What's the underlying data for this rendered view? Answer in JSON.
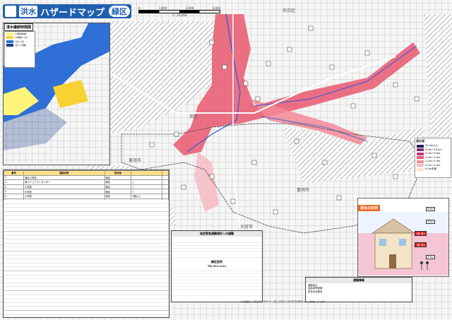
{
  "header": {
    "logo_text": "",
    "keyword": "洪水",
    "title": "ハザードマップ",
    "ward": "緑区",
    "scale_labels": [
      "0",
      "1,000",
      "2,000",
      "3,000"
    ],
    "scale_ratio": "1 : 20,000"
  },
  "map": {
    "place_labels": [
      {
        "text": "天白区",
        "name": "label-tempaku"
      },
      {
        "text": "南区",
        "name": "label-minami"
      },
      {
        "text": "豊明市",
        "name": "label-toyoake"
      },
      {
        "text": "大府市",
        "name": "label-obu"
      },
      {
        "text": "東海市",
        "name": "label-tokai"
      }
    ],
    "colors": {
      "flood_deep": "#e9586e",
      "flood_light": "#f6a9b8",
      "river": "#2a5bd7",
      "hatch": "#8a8a8a"
    }
  },
  "inset": {
    "title": "浸水継続時間図",
    "legend_items": [
      {
        "label": "12時間未満",
        "color": "#fef47a"
      },
      {
        "label": "12時間〜1日",
        "color": "#f8d232"
      },
      {
        "label": "1日〜3日",
        "color": "#2f6fd6"
      },
      {
        "label": "3日〜1週間",
        "color": "#1a3c8f"
      }
    ]
  },
  "legend": {
    "title": "浸水深",
    "items": [
      {
        "label": "10.0m以上",
        "color": "#1e1e5c"
      },
      {
        "label": "5.0m〜10.0m",
        "color": "#7e2c6e"
      },
      {
        "label": "3.0m〜5.0m",
        "color": "#c3376b"
      },
      {
        "label": "2.0m〜3.0m",
        "color": "#e9586e"
      },
      {
        "label": "1.0m〜2.0m",
        "color": "#f28a96"
      },
      {
        "label": "0.5m〜1.0m",
        "color": "#f7b8c0"
      },
      {
        "label": "0.5m未満",
        "color": "#fde3c0"
      }
    ]
  },
  "shelter_table": {
    "headers": [
      "番号",
      "施設名称",
      "所在地",
      "",
      ""
    ],
    "rows_left": [
      [
        "1",
        "南区小学校",
        "南区",
        "",
        ""
      ],
      [
        "2",
        "緑コミュニティセンター",
        "緑区",
        "○",
        ""
      ],
      [
        "3",
        "小学校",
        "緑区",
        "○",
        ""
      ],
      [
        "4",
        "中学校",
        "緑区",
        "○",
        ""
      ],
      [
        "5",
        "小学校",
        "緑区",
        "2階以上",
        ""
      ],
      [
        "6",
        "小学校",
        "緑区",
        "○",
        ""
      ]
    ]
  },
  "emergency_box": {
    "title": "指定緊急避難場所への避難",
    "phone_title": "緑区役所",
    "tel": "TEL 621-2111"
  },
  "house_diagram": {
    "title": "浸水の目安",
    "tags": [
      "5.0m",
      "3.0m",
      "2階 浸水",
      "1階 浸水",
      "0.5m"
    ]
  },
  "info_box": {
    "title": "避難情報",
    "lines": [
      "避難指示",
      "高齢者等避難",
      "緊急安全確保"
    ]
  },
  "footer": {
    "text": "この地図は、令和元年に作成された国土交通省の浸水想定区域図をもとに作成しています。"
  }
}
